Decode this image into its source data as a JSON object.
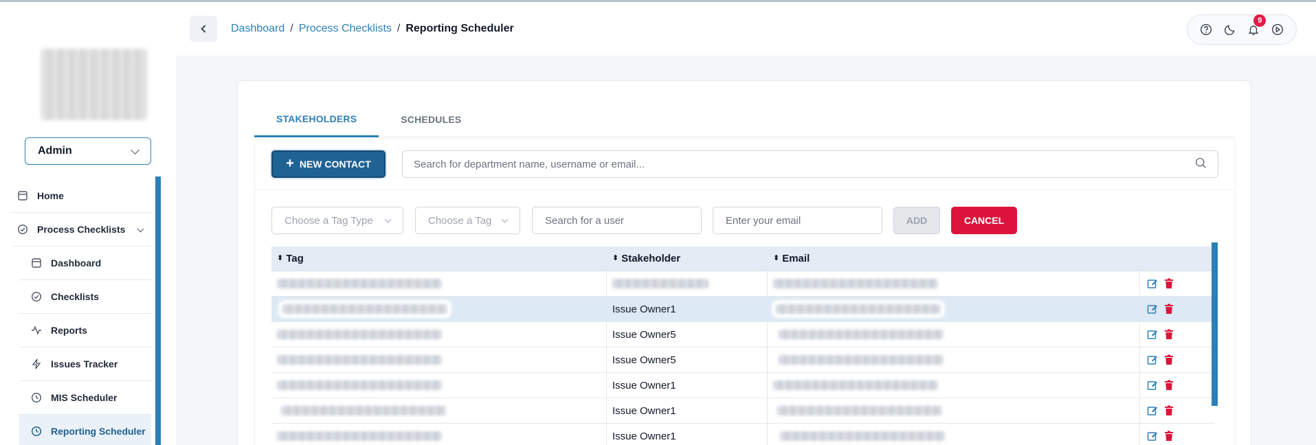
{
  "sidebar": {
    "role": "Admin",
    "items": [
      {
        "label": "Home",
        "icon": "home-icon"
      },
      {
        "label": "Process Checklists",
        "icon": "check-circle-icon"
      }
    ],
    "sub_items": [
      {
        "label": "Dashboard",
        "icon": "dashboard-icon"
      },
      {
        "label": "Checklists",
        "icon": "checklist-icon"
      },
      {
        "label": "Reports",
        "icon": "activity-icon"
      },
      {
        "label": "Issues Tracker",
        "icon": "bolt-icon"
      },
      {
        "label": "MIS Scheduler",
        "icon": "clock-icon"
      },
      {
        "label": "Reporting Scheduler",
        "icon": "clock-icon"
      }
    ]
  },
  "header": {
    "breadcrumb": [
      "Dashboard",
      "Process Checklists",
      "Reporting Scheduler"
    ],
    "separator": "/",
    "notification_count": "9",
    "icons": [
      "help-icon",
      "moon-icon",
      "bell-icon",
      "play-icon"
    ]
  },
  "tabs": [
    "STAKEHOLDERS",
    "SCHEDULES"
  ],
  "toolbar": {
    "new_contact_label": "NEW CONTACT",
    "search_placeholder": "Search for department name, username or email..."
  },
  "filters": {
    "tag_type_placeholder": "Choose a Tag Type",
    "tag_placeholder": "Choose a Tag",
    "user_placeholder": "Search for a user",
    "email_placeholder": "Enter your email",
    "add_label": "ADD",
    "cancel_label": "CANCEL"
  },
  "table": {
    "columns": [
      "Tag",
      "Stakeholder",
      "Email"
    ],
    "rows": [
      {
        "stakeholder": ""
      },
      {
        "stakeholder": "Issue Owner1"
      },
      {
        "stakeholder": "Issue Owner5"
      },
      {
        "stakeholder": "Issue Owner5"
      },
      {
        "stakeholder": "Issue Owner1"
      },
      {
        "stakeholder": "Issue Owner1"
      },
      {
        "stakeholder": "Issue Owner1"
      }
    ]
  },
  "colors": {
    "accent": "#2d7fb8",
    "primary_button": "#1f6394",
    "danger": "#dc143c",
    "badge": "#e11d48"
  }
}
